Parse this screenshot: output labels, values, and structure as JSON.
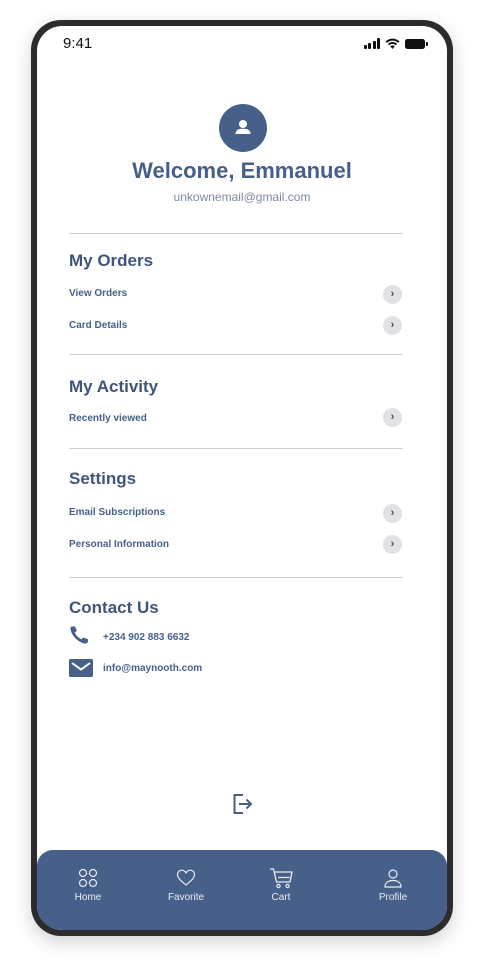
{
  "status_bar": {
    "time": "9:41"
  },
  "profile": {
    "greeting": "Welcome, Emmanuel",
    "email": "unkownemail@gmail.com",
    "avatar_icon": "user-icon"
  },
  "sections": {
    "orders": {
      "title": "My Orders",
      "items": [
        {
          "label": "View Orders"
        },
        {
          "label": "Card Details"
        }
      ]
    },
    "activity": {
      "title": "My Activity",
      "items": [
        {
          "label": "Recently viewed"
        }
      ]
    },
    "settings": {
      "title": "Settings",
      "items": [
        {
          "label": "Email Subscriptions"
        },
        {
          "label": "Personal Information"
        }
      ]
    },
    "contact": {
      "title": "Contact Us",
      "phone": "+234 902 883 6632",
      "email": "info@maynooth.com",
      "phone_icon": "phone-icon",
      "email_icon": "mail-icon"
    }
  },
  "chevron_glyph": "›",
  "logout_icon": "logout-icon",
  "tab_bar": {
    "tabs": [
      {
        "label": "Home",
        "icon": "grid-icon"
      },
      {
        "label": "Favorite",
        "icon": "heart-icon"
      },
      {
        "label": "Cart",
        "icon": "cart-icon"
      },
      {
        "label": "Profile",
        "icon": "user-icon"
      }
    ]
  },
  "colors": {
    "primary": "#46608a",
    "heading": "#3f557d",
    "subtle_text": "#7b8aa3",
    "divider": "#cfcfd4",
    "chevron_bg": "#e1e2e6"
  }
}
